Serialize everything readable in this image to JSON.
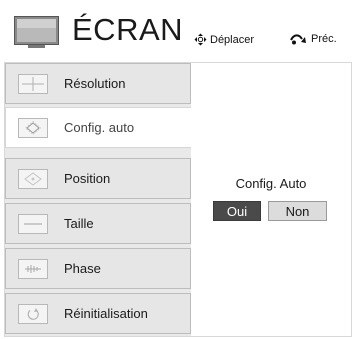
{
  "header": {
    "title": "ÉCRAN",
    "icon": "monitor-icon",
    "hints": {
      "move_label": "Déplacer",
      "move_icon": "four-way-arrow-icon",
      "back_label": "Préc.",
      "back_icon": "back-arrow-icon"
    }
  },
  "menu": {
    "items": [
      {
        "label": "Résolution",
        "icon": "resolution-icon"
      },
      {
        "label": "Config. auto",
        "icon": "auto-config-icon",
        "selected": true
      },
      {
        "label": "Position",
        "icon": "position-icon"
      },
      {
        "label": "Taille",
        "icon": "size-icon"
      },
      {
        "label": "Phase",
        "icon": "phase-icon"
      },
      {
        "label": "Réinitialisation",
        "icon": "reset-icon"
      }
    ]
  },
  "content": {
    "title": "Config. Auto",
    "yes_label": "Oui",
    "no_label": "Non"
  },
  "colors": {
    "menu_bg": "#e6e6e6",
    "selected_bg": "#ffffff",
    "yes_bg": "#4a4a4a",
    "no_bg": "#dcdcdc"
  }
}
